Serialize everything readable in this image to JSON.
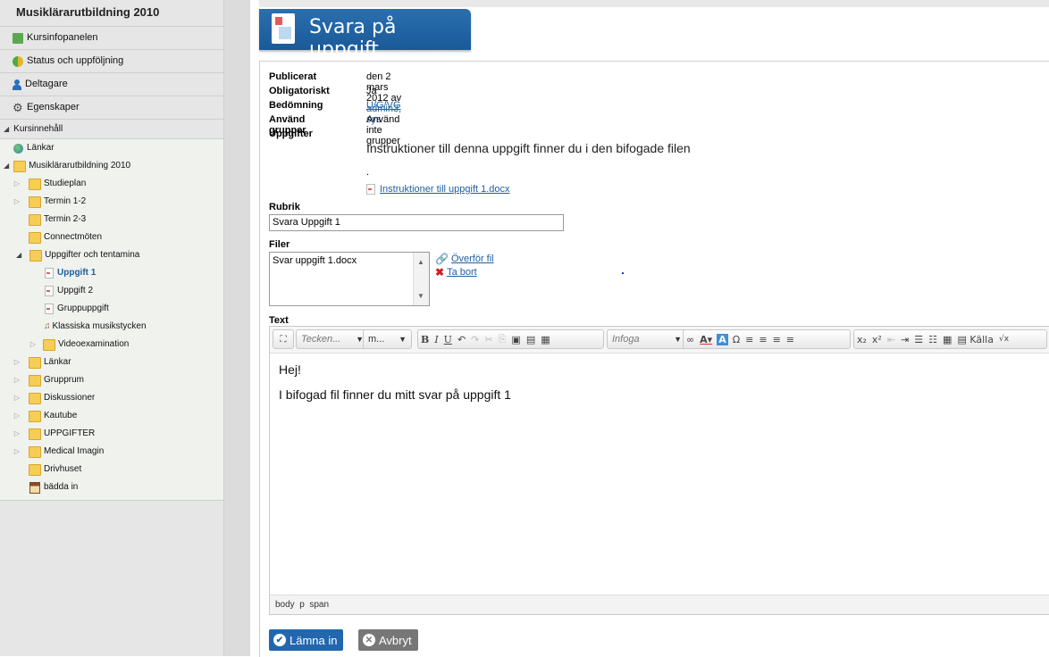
{
  "sidebar": {
    "title": "Musiklärarutbildning 2010",
    "nav": [
      {
        "label": "Kursinfopanelen",
        "icon": "panel-icon"
      },
      {
        "label": "Status och uppföljning",
        "icon": "status-icon"
      },
      {
        "label": "Deltagare",
        "icon": "person-icon"
      },
      {
        "label": "Egenskaper",
        "icon": "gear-icon"
      }
    ],
    "section_label": "Kursinnehåll",
    "tree": {
      "links_root": "Länkar",
      "course_root": "Musiklärarutbildning 2010",
      "studieplan": "Studieplan",
      "termin12": "Termin 1-2",
      "termin23": "Termin 2-3",
      "connect": "Connectmöten",
      "uppgifter": "Uppgifter och tentamina",
      "uppgift1": "Uppgift 1",
      "uppgift2": "Uppgift 2",
      "grupp": "Gruppuppgift",
      "klassiska": "Klassiska musikstycken",
      "video": "Videoexamination",
      "lankar": "Länkar",
      "grupprum": "Grupprum",
      "diskussioner": "Diskussioner",
      "kautube": "Kautube",
      "uppgifter_caps": "UPPGIFTER",
      "medical": "Medical Imagin",
      "drivhuset": "Drivhuset",
      "badda": "bädda in"
    }
  },
  "page": {
    "title": "Svara på uppgift"
  },
  "info": {
    "published_label": "Publicerat",
    "published_value": "den 2 mars 2012 av",
    "published_by": "admin3, sys",
    "mandatory_label": "Obligatoriskt",
    "mandatory_value": "Ja",
    "grading_label": "Bedömning",
    "grading_value": "U/G/VG",
    "groups_label": "Använd grupper",
    "groups_value": "Använd inte grupper",
    "tasks_label": "Uppgifter",
    "instructions": "Instruktioner till denna uppgift finner du i den bifogade filen",
    "dot": ".",
    "attachment": "Instruktioner till uppgift 1.docx"
  },
  "form": {
    "rubrik_label": "Rubrik",
    "rubrik_value": "Svara Uppgift 1",
    "files_label": "Filer",
    "files": [
      "Svar uppgift 1.docx"
    ],
    "upload_label": "Överför fil",
    "delete_label": "Ta bort",
    "text_label": "Text"
  },
  "editor": {
    "font_combo": "Tecken...",
    "size_combo": "m...",
    "insert_combo": "Infoga",
    "source_label": "Källa",
    "body_lines": [
      "Hej!",
      "I bifogad fil finner du mitt svar på uppgift 1"
    ],
    "path": "body  p  span"
  },
  "actions": {
    "submit": "Lämna in",
    "cancel": "Avbryt"
  },
  "colors": {
    "brand_blue": "#1f5fa3",
    "title_bar": "#2267ae",
    "sidebar_bg": "#e6e6e6"
  }
}
